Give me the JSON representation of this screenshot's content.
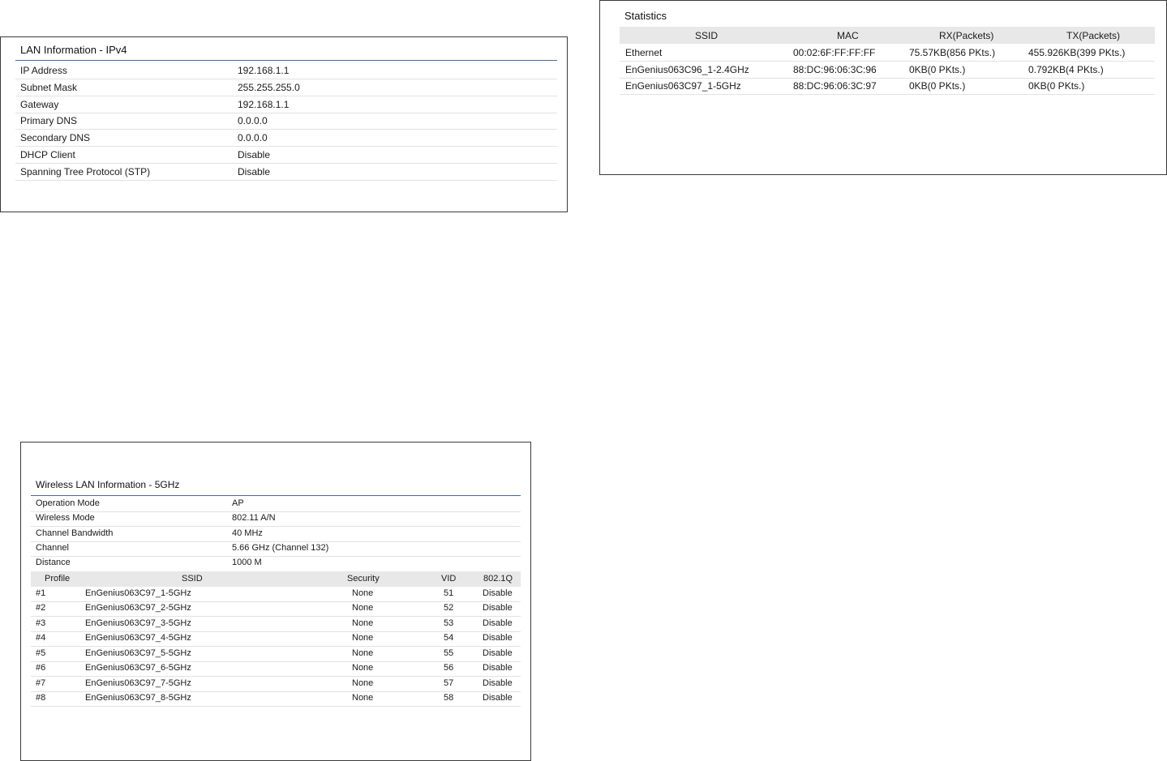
{
  "lan": {
    "title": "LAN Information - IPv4",
    "rows": [
      {
        "label": "IP Address",
        "value": "192.168.1.1"
      },
      {
        "label": "Subnet Mask",
        "value": "255.255.255.0"
      },
      {
        "label": "Gateway",
        "value": "192.168.1.1"
      },
      {
        "label": "Primary DNS",
        "value": "0.0.0.0"
      },
      {
        "label": "Secondary DNS",
        "value": "0.0.0.0"
      },
      {
        "label": "DHCP Client",
        "value": "Disable"
      },
      {
        "label": "Spanning Tree Protocol (STP)",
        "value": "Disable"
      }
    ]
  },
  "stats": {
    "title": "Statistics",
    "columns": [
      "SSID",
      "MAC",
      "RX(Packets)",
      "TX(Packets)"
    ],
    "rows": [
      {
        "ssid": "Ethernet",
        "mac": "00:02:6F:FF:FF:FF",
        "rx": "75.57KB(856 PKts.)",
        "tx": "455.926KB(399 PKts.)"
      },
      {
        "ssid": "EnGenius063C96_1-2.4GHz",
        "mac": "88:DC:96:06:3C:96",
        "rx": "0KB(0 PKts.)",
        "tx": "0.792KB(4 PKts.)"
      },
      {
        "ssid": "EnGenius063C97_1-5GHz",
        "mac": "88:DC:96:06:3C:97",
        "rx": "0KB(0 PKts.)",
        "tx": "0KB(0 PKts.)"
      }
    ]
  },
  "wlan": {
    "title": "Wireless LAN Information - 5GHz",
    "rows": [
      {
        "label": "Operation Mode",
        "value": "AP"
      },
      {
        "label": "Wireless Mode",
        "value": "802.11 A/N"
      },
      {
        "label": "Channel Bandwidth",
        "value": "40 MHz"
      },
      {
        "label": "Channel",
        "value": "5.66 GHz (Channel 132)"
      },
      {
        "label": "Distance",
        "value": "1000 M"
      }
    ],
    "profile_columns": [
      "Profile",
      "SSID",
      "Security",
      "VID",
      "802.1Q"
    ],
    "profiles": [
      {
        "profile": "#1",
        "ssid": "EnGenius063C97_1-5GHz",
        "security": "None",
        "vid": "51",
        "dot1q": "Disable"
      },
      {
        "profile": "#2",
        "ssid": "EnGenius063C97_2-5GHz",
        "security": "None",
        "vid": "52",
        "dot1q": "Disable"
      },
      {
        "profile": "#3",
        "ssid": "EnGenius063C97_3-5GHz",
        "security": "None",
        "vid": "53",
        "dot1q": "Disable"
      },
      {
        "profile": "#4",
        "ssid": "EnGenius063C97_4-5GHz",
        "security": "None",
        "vid": "54",
        "dot1q": "Disable"
      },
      {
        "profile": "#5",
        "ssid": "EnGenius063C97_5-5GHz",
        "security": "None",
        "vid": "55",
        "dot1q": "Disable"
      },
      {
        "profile": "#6",
        "ssid": "EnGenius063C97_6-5GHz",
        "security": "None",
        "vid": "56",
        "dot1q": "Disable"
      },
      {
        "profile": "#7",
        "ssid": "EnGenius063C97_7-5GHz",
        "security": "None",
        "vid": "57",
        "dot1q": "Disable"
      },
      {
        "profile": "#8",
        "ssid": "EnGenius063C97_8-5GHz",
        "security": "None",
        "vid": "58",
        "dot1q": "Disable"
      }
    ]
  }
}
